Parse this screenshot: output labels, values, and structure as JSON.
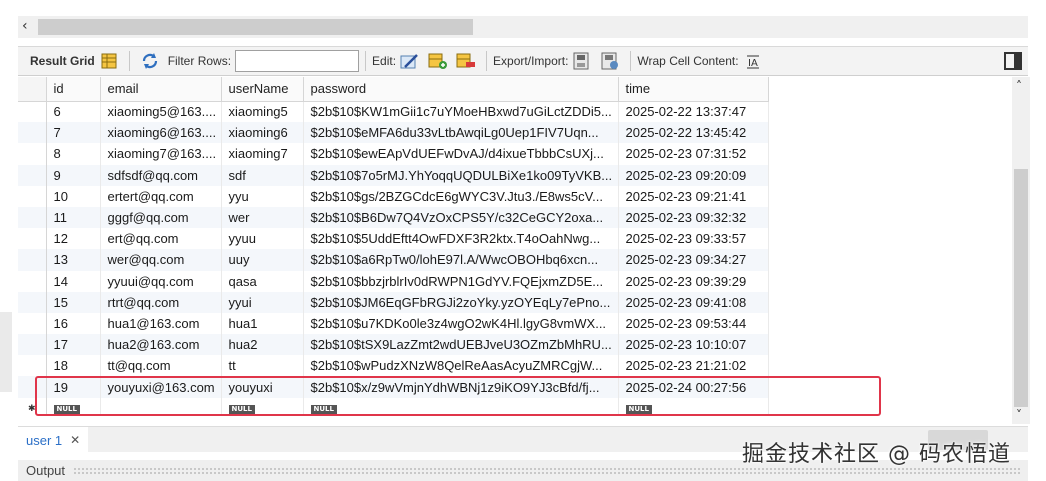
{
  "toolbar": {
    "result_grid": "Result Grid",
    "filter_rows": "Filter Rows:",
    "filter_value": "",
    "edit": "Edit:",
    "export_import": "Export/Import:",
    "wrap_cell": "Wrap Cell Content:"
  },
  "grid": {
    "columns": [
      "id",
      "email",
      "userName",
      "password",
      "time"
    ],
    "rows": [
      [
        "6",
        "xiaoming5@163....",
        "xiaoming5",
        "$2b$10$KW1mGii1c7uYMoeHBxwd7uGiLctZDDi5...",
        "2025-02-22 13:37:47"
      ],
      [
        "7",
        "xiaoming6@163....",
        "xiaoming6",
        "$2b$10$eMFA6du33vLtbAwqiLg0Uep1FIV7Uqn...",
        "2025-02-22 13:45:42"
      ],
      [
        "8",
        "xiaoming7@163....",
        "xiaoming7",
        "$2b$10$ewEApVdUEFwDvAJ/d4ixueTbbbCsUXj...",
        "2025-02-23 07:31:52"
      ],
      [
        "9",
        "sdfsdf@qq.com",
        "sdf",
        "$2b$10$7o5rMJ.YhYoqqUQDULBiXe1ko09TyVKB...",
        "2025-02-23 09:20:09"
      ],
      [
        "10",
        "ertert@qq.com",
        "yyu",
        "$2b$10$gs/2BZGCdcE6gWYC3V.Jtu3./E8ws5cV...",
        "2025-02-23 09:21:41"
      ],
      [
        "11",
        "gggf@qq.com",
        "wer",
        "$2b$10$B6Dw7Q4VzOxCPS5Y/c32CeGCY2oxa...",
        "2025-02-23 09:32:32"
      ],
      [
        "12",
        "ert@qq.com",
        "yyuu",
        "$2b$10$5UddEftt4OwFDXF3R2ktx.T4oOahNwg...",
        "2025-02-23 09:33:57"
      ],
      [
        "13",
        "wer@qq.com",
        "uuy",
        "$2b$10$a6RpTw0/lohE97l.A/WwcOBOHbq6xcn...",
        "2025-02-23 09:34:27"
      ],
      [
        "14",
        "yyuui@qq.com",
        "qasa",
        "$2b$10$bbzjrblrIv0dRWPN1GdYV.FQEjxmZD5E...",
        "2025-02-23 09:39:29"
      ],
      [
        "15",
        "rtrt@qq.com",
        "yyui",
        "$2b$10$JM6EqGFbRGJi2zoYky.yzOYEqLy7ePno...",
        "2025-02-23 09:41:08"
      ],
      [
        "16",
        "hua1@163.com",
        "hua1",
        "$2b$10$u7KDKo0le3z4wgO2wK4Hl.lgyG8vmWX...",
        "2025-02-23 09:53:44"
      ],
      [
        "17",
        "hua2@163.com",
        "hua2",
        "$2b$10$tSX9LazZmt2wdUEBJveU3OZmZbMhRU...",
        "2025-02-23 10:10:07"
      ],
      [
        "18",
        "tt@qq.com",
        "tt",
        "$2b$10$wPudzXNzW8QelReAasAcyuZMRCgjW...",
        "2025-02-23 21:21:02"
      ],
      [
        "19",
        "youyuxi@163.com",
        "youyuxi",
        "$2b$10$x/z9wVmjnYdhWBNj1z9iKO9YJ3cBfd/fj...",
        "2025-02-24 00:27:56"
      ]
    ],
    "null_label": "NULL",
    "new_row_marker": "✱"
  },
  "tabs": [
    {
      "label": "user 1"
    }
  ],
  "output": {
    "label": "Output"
  },
  "watermark": "掘金技术社区 @ 码农悟道",
  "colors": {
    "highlight": "#e0354a",
    "tab_text": "#2b6fc7"
  }
}
